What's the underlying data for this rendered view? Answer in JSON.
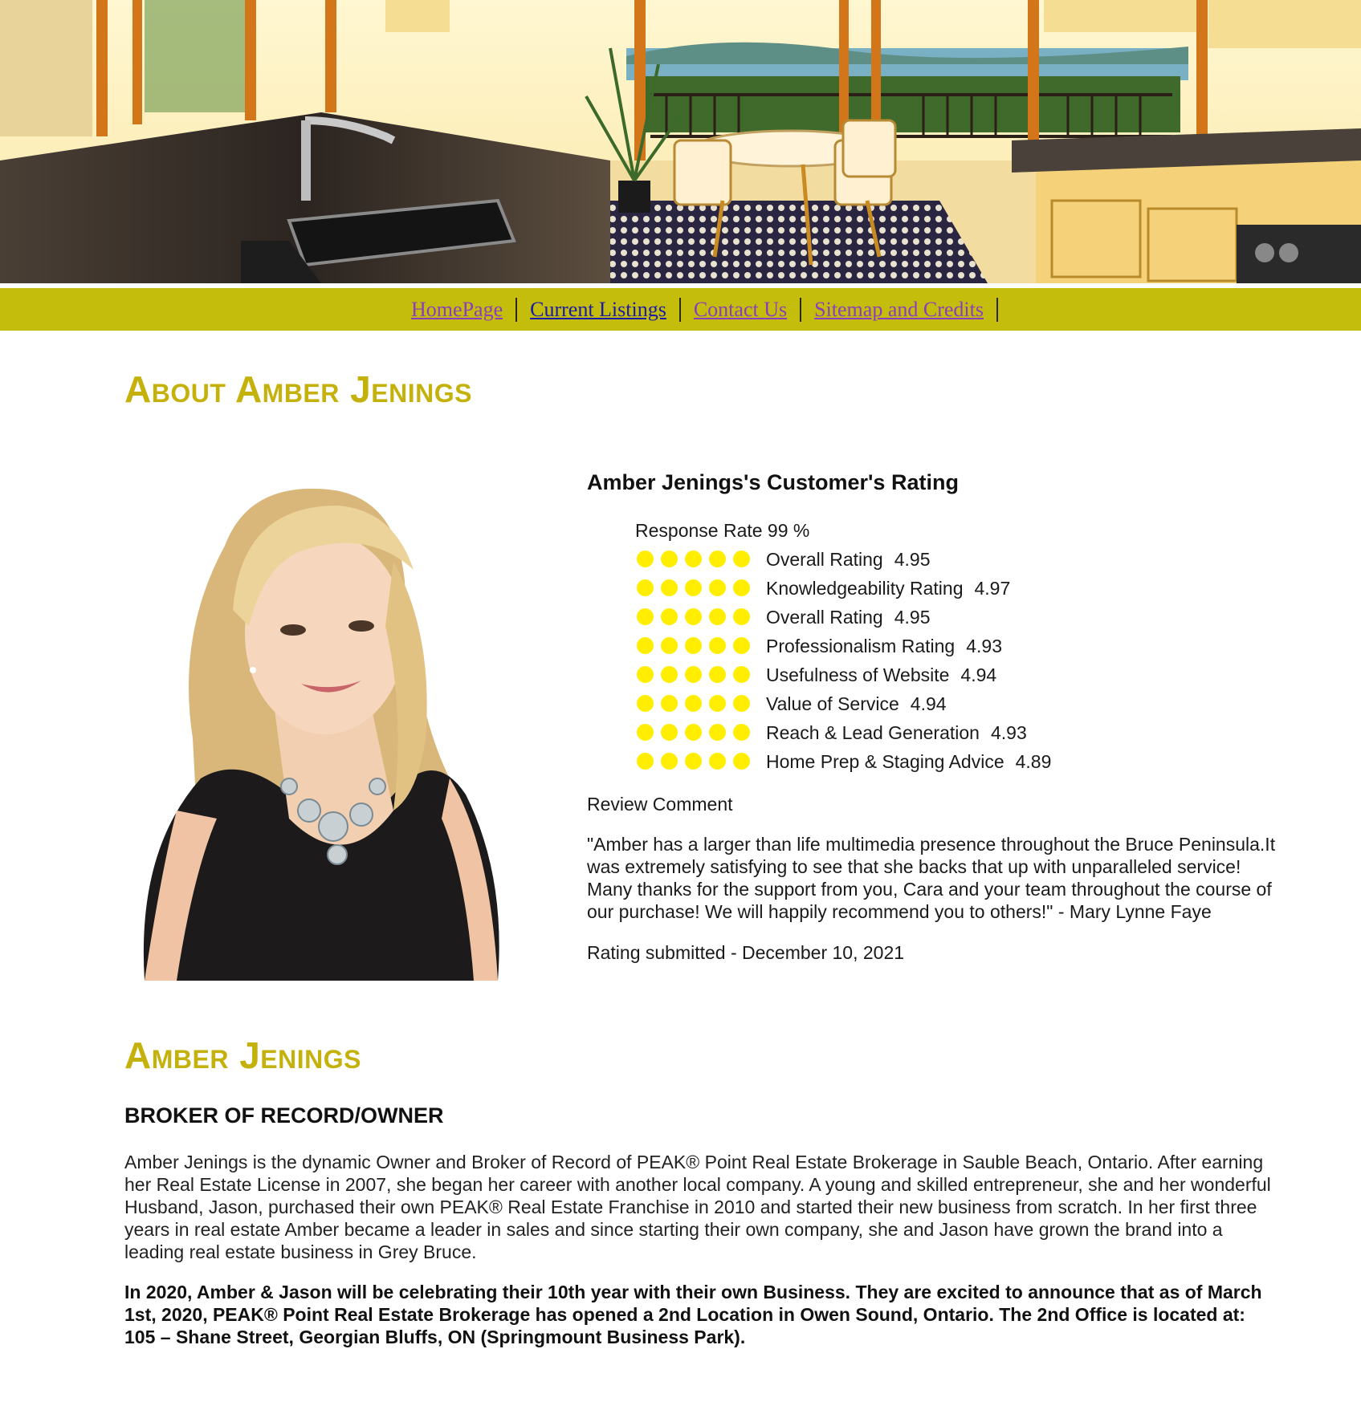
{
  "nav": {
    "items": [
      {
        "label": "HomePage",
        "state": "visited"
      },
      {
        "label": "Current Listings",
        "state": "active"
      },
      {
        "label": "Contact Us",
        "state": "visited"
      },
      {
        "label": "Sitemap and Credits",
        "state": "visited"
      }
    ]
  },
  "about": {
    "heading": "About Amber Jenings"
  },
  "rating": {
    "title": "Amber Jenings's Customer's Rating",
    "response_rate": "Response Rate 99 %",
    "rows": [
      {
        "label": "Overall Rating",
        "value": "4.95",
        "stars": 5
      },
      {
        "label": "Knowledgeability Rating",
        "value": "4.97",
        "stars": 5
      },
      {
        "label": "Overall Rating",
        "value": "4.95",
        "stars": 5
      },
      {
        "label": "Professionalism Rating",
        "value": "4.93",
        "stars": 5
      },
      {
        "label": "Usefulness of Website",
        "value": "4.94",
        "stars": 5
      },
      {
        "label": "Value of Service",
        "value": "4.94",
        "stars": 5
      },
      {
        "label": "Reach & Lead Generation",
        "value": "4.93",
        "stars": 5
      },
      {
        "label": "Home Prep & Staging Advice",
        "value": "4.89",
        "stars": 5
      }
    ],
    "review_heading": "Review Comment",
    "review_text": "\"Amber has a larger than life multimedia presence throughout the Bruce Peninsula.It was extremely satisfying to see that she backs that up with unparalleled service! Many thanks for the support from you, Cara and your team throughout the course of our purchase! We will happily recommend you to others!\" - Mary Lynne Faye",
    "submitted": "Rating submitted - December 10, 2021"
  },
  "bio": {
    "name_heading": "Amber Jenings",
    "title": "BROKER OF RECORD/OWNER",
    "paragraph1": "Amber Jenings is the dynamic Owner and Broker of Record of PEAK® Point Real Estate Brokerage in Sauble Beach, Ontario. After earning her Real Estate License in 2007, she began her career with another local company. A young and skilled entrepreneur, she and her wonderful Husband, Jason, purchased their own PEAK® Real Estate Franchise in 2010 and started their new business from scratch. In her first three years in real estate Amber became a leader in sales and since starting their own company, she and Jason have grown the brand into a leading real estate business in Grey Bruce.",
    "paragraph2": "In 2020, Amber & Jason will be celebrating their 10th year with their own Business. They are excited to announce that as of March 1st, 2020, PEAK® Point Real Estate Brokerage has opened a 2nd Location in Owen Sound, Ontario. The 2nd Office is located at: 105 – Shane Street, Georgian Bluffs, ON (Springmount Business Park)."
  },
  "colors": {
    "nav_bg": "#c5bd0c",
    "heading": "#c5b10c",
    "rating_dot": "#ffee00",
    "link_visited": "#8a3dbd",
    "link_active": "#1a1aa8"
  },
  "icons": {
    "rating_dot": "filled-circle-icon"
  }
}
